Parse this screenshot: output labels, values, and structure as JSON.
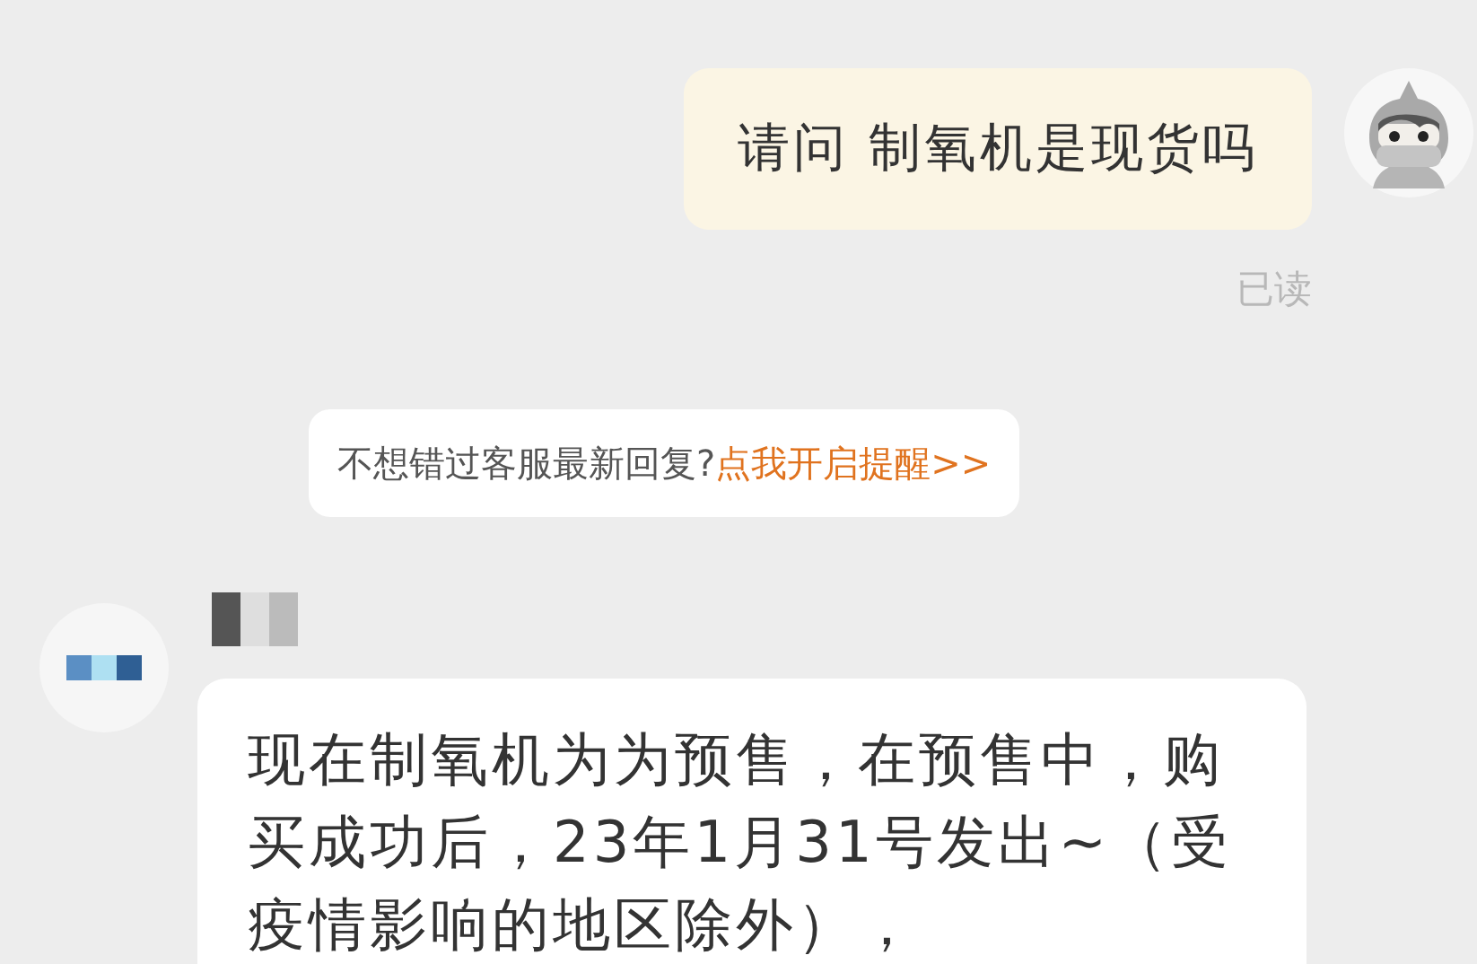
{
  "messages": [
    {
      "kind": "outgoing",
      "text": "请问 制氧机是现货吗",
      "receipt": "已读"
    },
    {
      "kind": "notice",
      "text": "不想错过客服最新回复?",
      "link": "点我开启提醒>>"
    },
    {
      "kind": "incoming",
      "text": "现在制氧机为为预售，在预售中，购买成功后，23年1月31号发出~（受疫情影响的地区除外），"
    }
  ]
}
